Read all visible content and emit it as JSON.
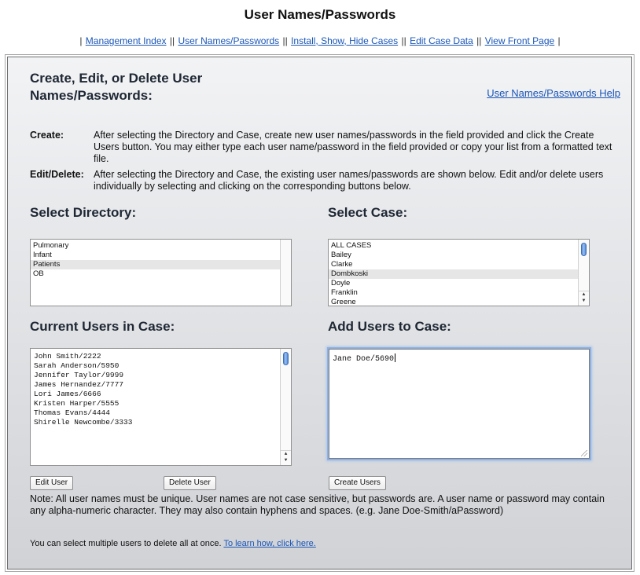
{
  "page": {
    "title": "User Names/Passwords"
  },
  "nav": {
    "items": [
      "Management Index",
      "User Names/Passwords",
      "Install, Show, Hide Cases",
      "Edit Case Data",
      "View Front Page"
    ]
  },
  "panel": {
    "heading": "Create, Edit, or Delete User Names/Passwords:",
    "help_link": "User Names/Passwords Help"
  },
  "instructions": {
    "create_label": "Create:",
    "create_text": "After selecting the Directory and Case, create new user names/passwords in the field provided and click the Create Users button. You may either type each user name/password in the field provided or copy your list from a formatted text file.",
    "edit_label": "Edit/Delete:",
    "edit_text": "After selecting the Directory and Case, the existing user names/passwords are shown below. Edit and/or delete users individually by selecting and clicking on the corresponding buttons below."
  },
  "directory": {
    "heading": "Select Directory:",
    "options": [
      "Pulmonary",
      "Infant",
      "Patients",
      "OB"
    ],
    "selected": "Patients"
  },
  "case": {
    "heading": "Select Case:",
    "options": [
      "ALL CASES",
      "Bailey",
      "Clarke",
      "Dombkoski",
      "Doyle",
      "Franklin",
      "Greene"
    ],
    "selected": "Dombkoski"
  },
  "current_users": {
    "heading": "Current Users in Case:",
    "users": [
      "John Smith/2222",
      "Sarah Anderson/5950",
      "Jennifer Taylor/9999",
      "James Hernandez/7777",
      "Lori James/6666",
      "Kristen Harper/5555",
      "Thomas Evans/4444",
      "Shirelle Newcombe/3333"
    ],
    "edit_button": "Edit User",
    "delete_button": "Delete User"
  },
  "add_users": {
    "heading": "Add Users to Case:",
    "value": "Jane Doe/5690",
    "create_button": "Create Users"
  },
  "note": {
    "text": "Note: All user names must be unique. User names are not case sensitive, but passwords are. A user name or password may contain any alpha-numeric character. They may also contain hyphens and spaces. (e.g. Jane Doe-Smith/aPassword)",
    "footnote_text": "You can select multiple users to delete all at once.",
    "footnote_link": "To learn how, click here."
  },
  "colors": {
    "link": "#1a56b8",
    "heading": "#1e2733",
    "scroll_thumb": "#5c8fd8",
    "focus_ring": "#8fb0e0"
  },
  "icons": {
    "scroll_arrows": "scroll-arrows-icon",
    "resize_grip": "resize-grip-icon"
  }
}
